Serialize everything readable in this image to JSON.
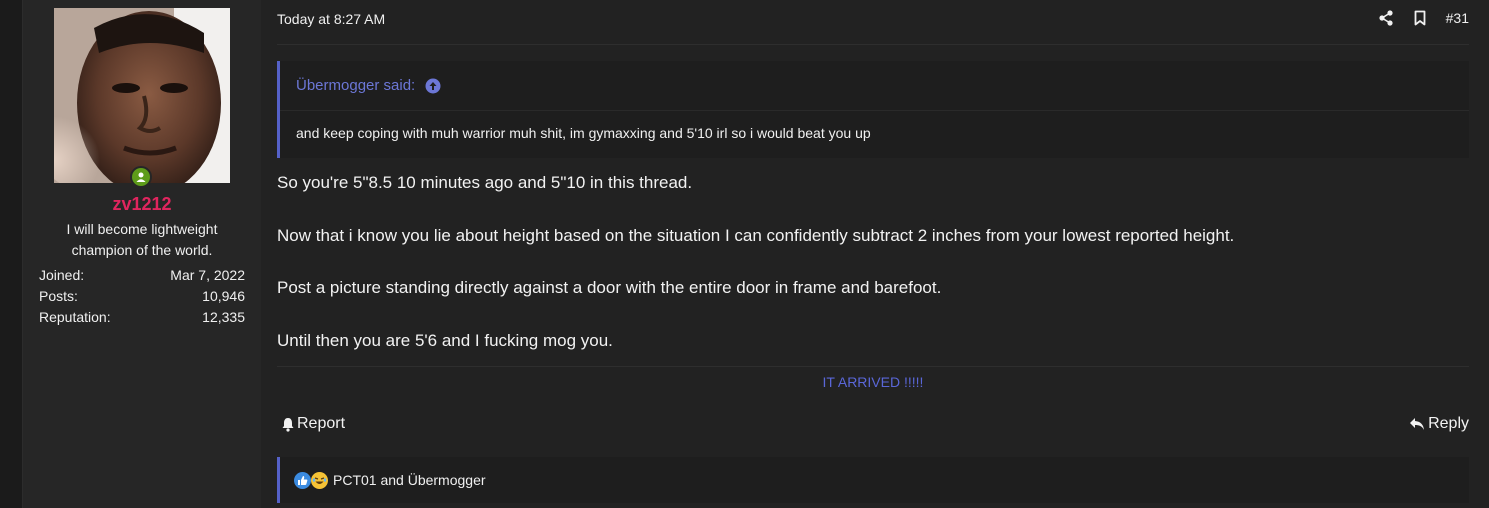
{
  "user": {
    "username": "zv1212",
    "title": "I will become lightweight champion of the world.",
    "stats": [
      {
        "label": "Joined:",
        "value": "Mar 7, 2022"
      },
      {
        "label": "Posts:",
        "value": "10,946"
      },
      {
        "label": "Reputation:",
        "value": "12,335"
      }
    ],
    "online_icon": "online-user-icon"
  },
  "post": {
    "timestamp": "Today at 8:27 AM",
    "number": "#31",
    "icons": [
      "share-icon",
      "bookmark-icon"
    ],
    "quote": {
      "author": "Übermogger said:",
      "body": "and keep coping with muh warrior muh shit, im gymaxxing and 5'10 irl so i would beat you up"
    },
    "paragraphs": [
      "So you're 5\"8.5 10 minutes ago and 5\"10 in this thread.",
      "Now that i know you lie about height based on the situation I can confidently subtract 2 inches from your lowest reported height.",
      "Post a picture standing directly against a door with the entire door in frame and barefoot.",
      "Until then you are 5'6 and I fucking mog you."
    ],
    "signature": "IT ARRIVED !!!!!"
  },
  "actions": {
    "report": "Report",
    "reply": "Reply"
  },
  "reactions": {
    "names": "PCT01 and Übermogger",
    "icons": [
      "like-icon",
      "laugh-icon"
    ]
  },
  "colors": {
    "username": "#e0255e",
    "accent": "#5561c8",
    "online": "#5e9c1a"
  }
}
